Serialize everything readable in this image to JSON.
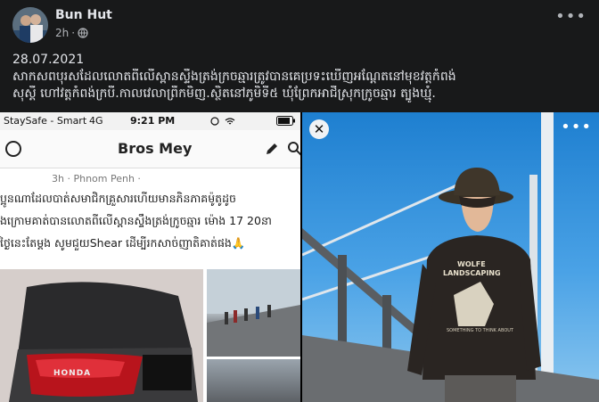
{
  "post": {
    "author": "Bun Hut",
    "time": "2h",
    "date": "28.07.2021",
    "text_lines": [
      "សាកសពបុរសដែលលោតពីលើស្ពានស្ទឹងត្រង់ក្រចឆ្មារត្រូវបានគេប្រទះឃើញអណ្តែតនៅមុខវត្តកំពង់",
      "សុស្តី ហៅវត្តកំពង់ក្របី.កាលវេលាព្រឹកមិញ.ស្ថិតនៅភូមិទី៥ ឃុំព្រែកអាជីស្រុកក្រូចឆ្មារ ត្បូងឃ្មុំ."
    ]
  },
  "screenshot": {
    "carrier": "StaySafe - Smart",
    "network": "4G",
    "clock": "9:21 PM",
    "page_title": "Bros Mey",
    "post_meta": "3h · Phnom Penh ·",
    "post_text_lines": [
      "ប្អូនណាដែលបាត់សមាជិកគ្រួសារហើយមានភិនភាគម៉ូតូដូច",
      "ងក្រោមគាត់បានលោតពីលើស្ពានស្ទឹងត្រង់ក្រូចឆ្មារ ម៉ោង 17 20នា",
      "ថ្ងៃនេះតែម្តង សូមជួយShear ដើម្បីរកសាច់ញាតិគាត់ផង🙏"
    ],
    "moto_brand": "HONDA"
  },
  "photo": {
    "sweater_line1": "WOLFE",
    "sweater_line2": "LANDSCAPING",
    "sweater_line3": "SOMETHING TO THINK ABOUT"
  }
}
